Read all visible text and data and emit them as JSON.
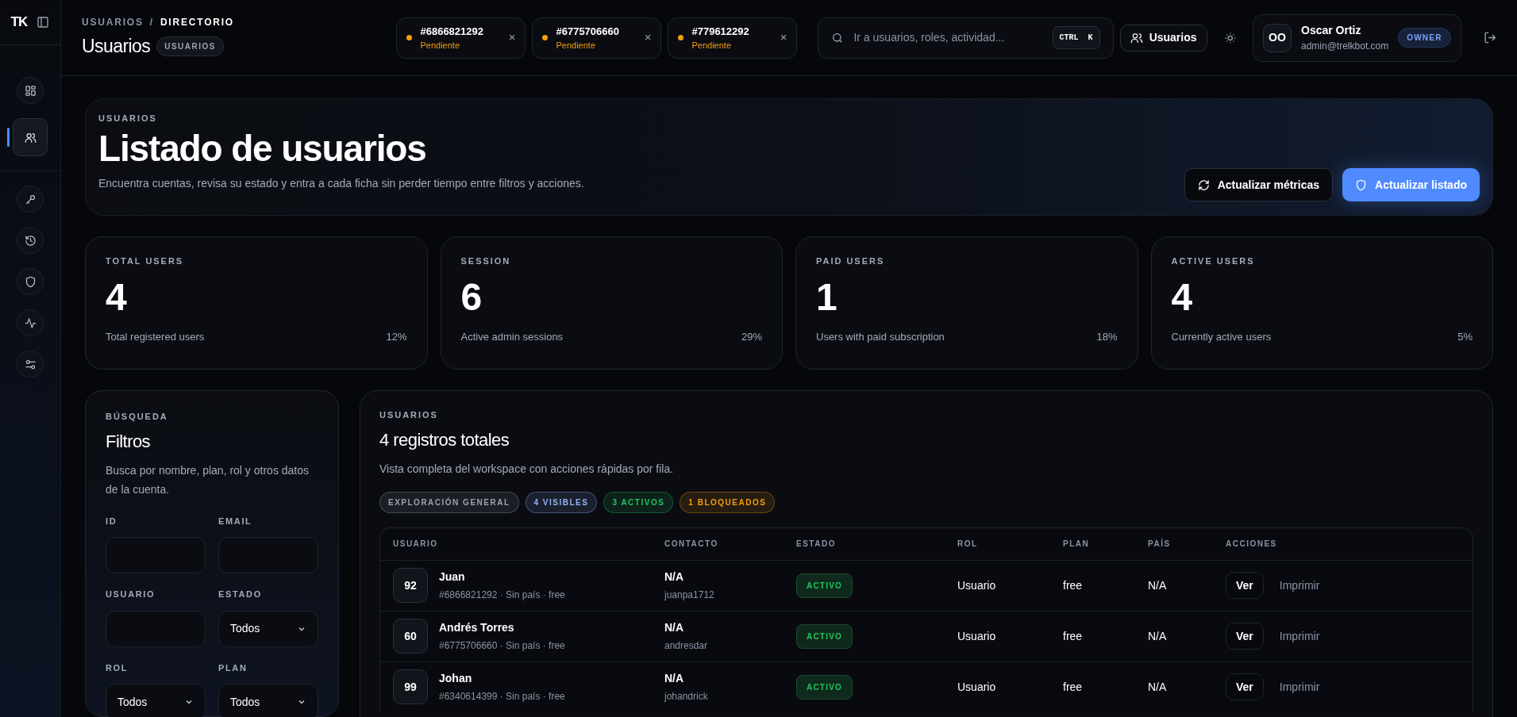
{
  "sidebar": {
    "logo": "TK",
    "items": [
      {
        "selected": false
      },
      {
        "selected": true
      },
      {
        "selected": false
      },
      {
        "selected": false
      },
      {
        "selected": false
      },
      {
        "selected": false
      },
      {
        "selected": false
      }
    ]
  },
  "header": {
    "breadcrumb": [
      "USUARIOS",
      "DIRECTORIO"
    ],
    "breadcrumb_separator": "/",
    "title": "Usuarios",
    "badge": "USUARIOS",
    "tabs": [
      {
        "id": "#6866821292",
        "status": "Pendiente",
        "close": "×"
      },
      {
        "id": "#6775706660",
        "status": "Pendiente",
        "close": "×"
      },
      {
        "id": "#779612292",
        "status": "Pendiente",
        "close": "×"
      }
    ],
    "search": {
      "placeholder": "Ir a usuarios, roles, actividad...",
      "shortcut": "CTRL  K"
    },
    "context_button": "Usuarios",
    "user": {
      "initials": "OO",
      "name": "Oscar Ortiz",
      "email": "admin@trelkbot.com",
      "role": "OWNER"
    }
  },
  "hero": {
    "eyebrow": "USUARIOS",
    "title": "Listado de usuarios",
    "subtitle": "Encuentra cuentas, revisa su estado y entra a cada ficha sin perder tiempo entre filtros y acciones.",
    "buttons": [
      {
        "kind": "secondary",
        "label": "Actualizar métricas"
      },
      {
        "kind": "primary",
        "label": "Actualizar listado"
      }
    ]
  },
  "stats": [
    {
      "label": "TOTAL USERS",
      "value": "4",
      "caption": "Total registered users",
      "percent": "12%"
    },
    {
      "label": "SESSION",
      "value": "6",
      "caption": "Active admin sessions",
      "percent": "29%"
    },
    {
      "label": "PAID USERS",
      "value": "1",
      "caption": "Users with paid subscription",
      "percent": "18%"
    },
    {
      "label": "ACTIVE USERS",
      "value": "4",
      "caption": "Currently active users",
      "percent": "5%"
    }
  ],
  "filters": {
    "eyebrow": "BÚSQUEDA",
    "title": "Filtros",
    "description": "Busca por nombre, plan, rol y otros datos de la cuenta.",
    "fields": [
      {
        "kind": "input",
        "label": "ID"
      },
      {
        "kind": "input",
        "label": "EMAIL"
      },
      {
        "kind": "input",
        "label": "USUARIO"
      },
      {
        "kind": "select",
        "label": "ESTADO",
        "value": "Todos"
      },
      {
        "kind": "select",
        "label": "ROL",
        "value": "Todos"
      },
      {
        "kind": "select",
        "label": "PLAN",
        "value": "Todos"
      }
    ]
  },
  "table": {
    "eyebrow": "USUARIOS",
    "title": "4 registros totales",
    "description": "Vista completa del workspace con acciones rápidas por fila.",
    "chips": [
      {
        "label": "EXPLORACIÓN GENERAL",
        "color": "#9ca3af"
      },
      {
        "label": "4 VISIBLES",
        "color": "#93b4f5"
      },
      {
        "label": "3 ACTIVOS",
        "color": "#22c55e"
      },
      {
        "label": "1 BLOQUEADOS",
        "color": "#f59e0b"
      }
    ],
    "columns": [
      "USUARIO",
      "CONTACTO",
      "ESTADO",
      "ROL",
      "PLAN",
      "PAÍS",
      "ACCIONES"
    ],
    "rows": [
      {
        "avatar": "92",
        "name": "Juan",
        "meta": "#6866821292 · Sin país · free",
        "contact": "N/A",
        "username": "juanpa1712",
        "status": "ACTIVO",
        "role": "Usuario",
        "plan": "free",
        "country": "N/A",
        "view": "Ver",
        "print": "Imprimir"
      },
      {
        "avatar": "60",
        "name": "Andrés Torres",
        "meta": "#6775706660 · Sin país · free",
        "contact": "N/A",
        "username": "andresdar",
        "status": "ACTIVO",
        "role": "Usuario",
        "plan": "free",
        "country": "N/A",
        "view": "Ver",
        "print": "Imprimir"
      },
      {
        "avatar": "99",
        "name": "Johan",
        "meta": "#6340614399 · Sin país · free",
        "contact": "N/A",
        "username": "johandrick",
        "status": "ACTIVO",
        "role": "Usuario",
        "plan": "free",
        "country": "N/A",
        "view": "Ver",
        "print": "Imprimir"
      }
    ]
  }
}
